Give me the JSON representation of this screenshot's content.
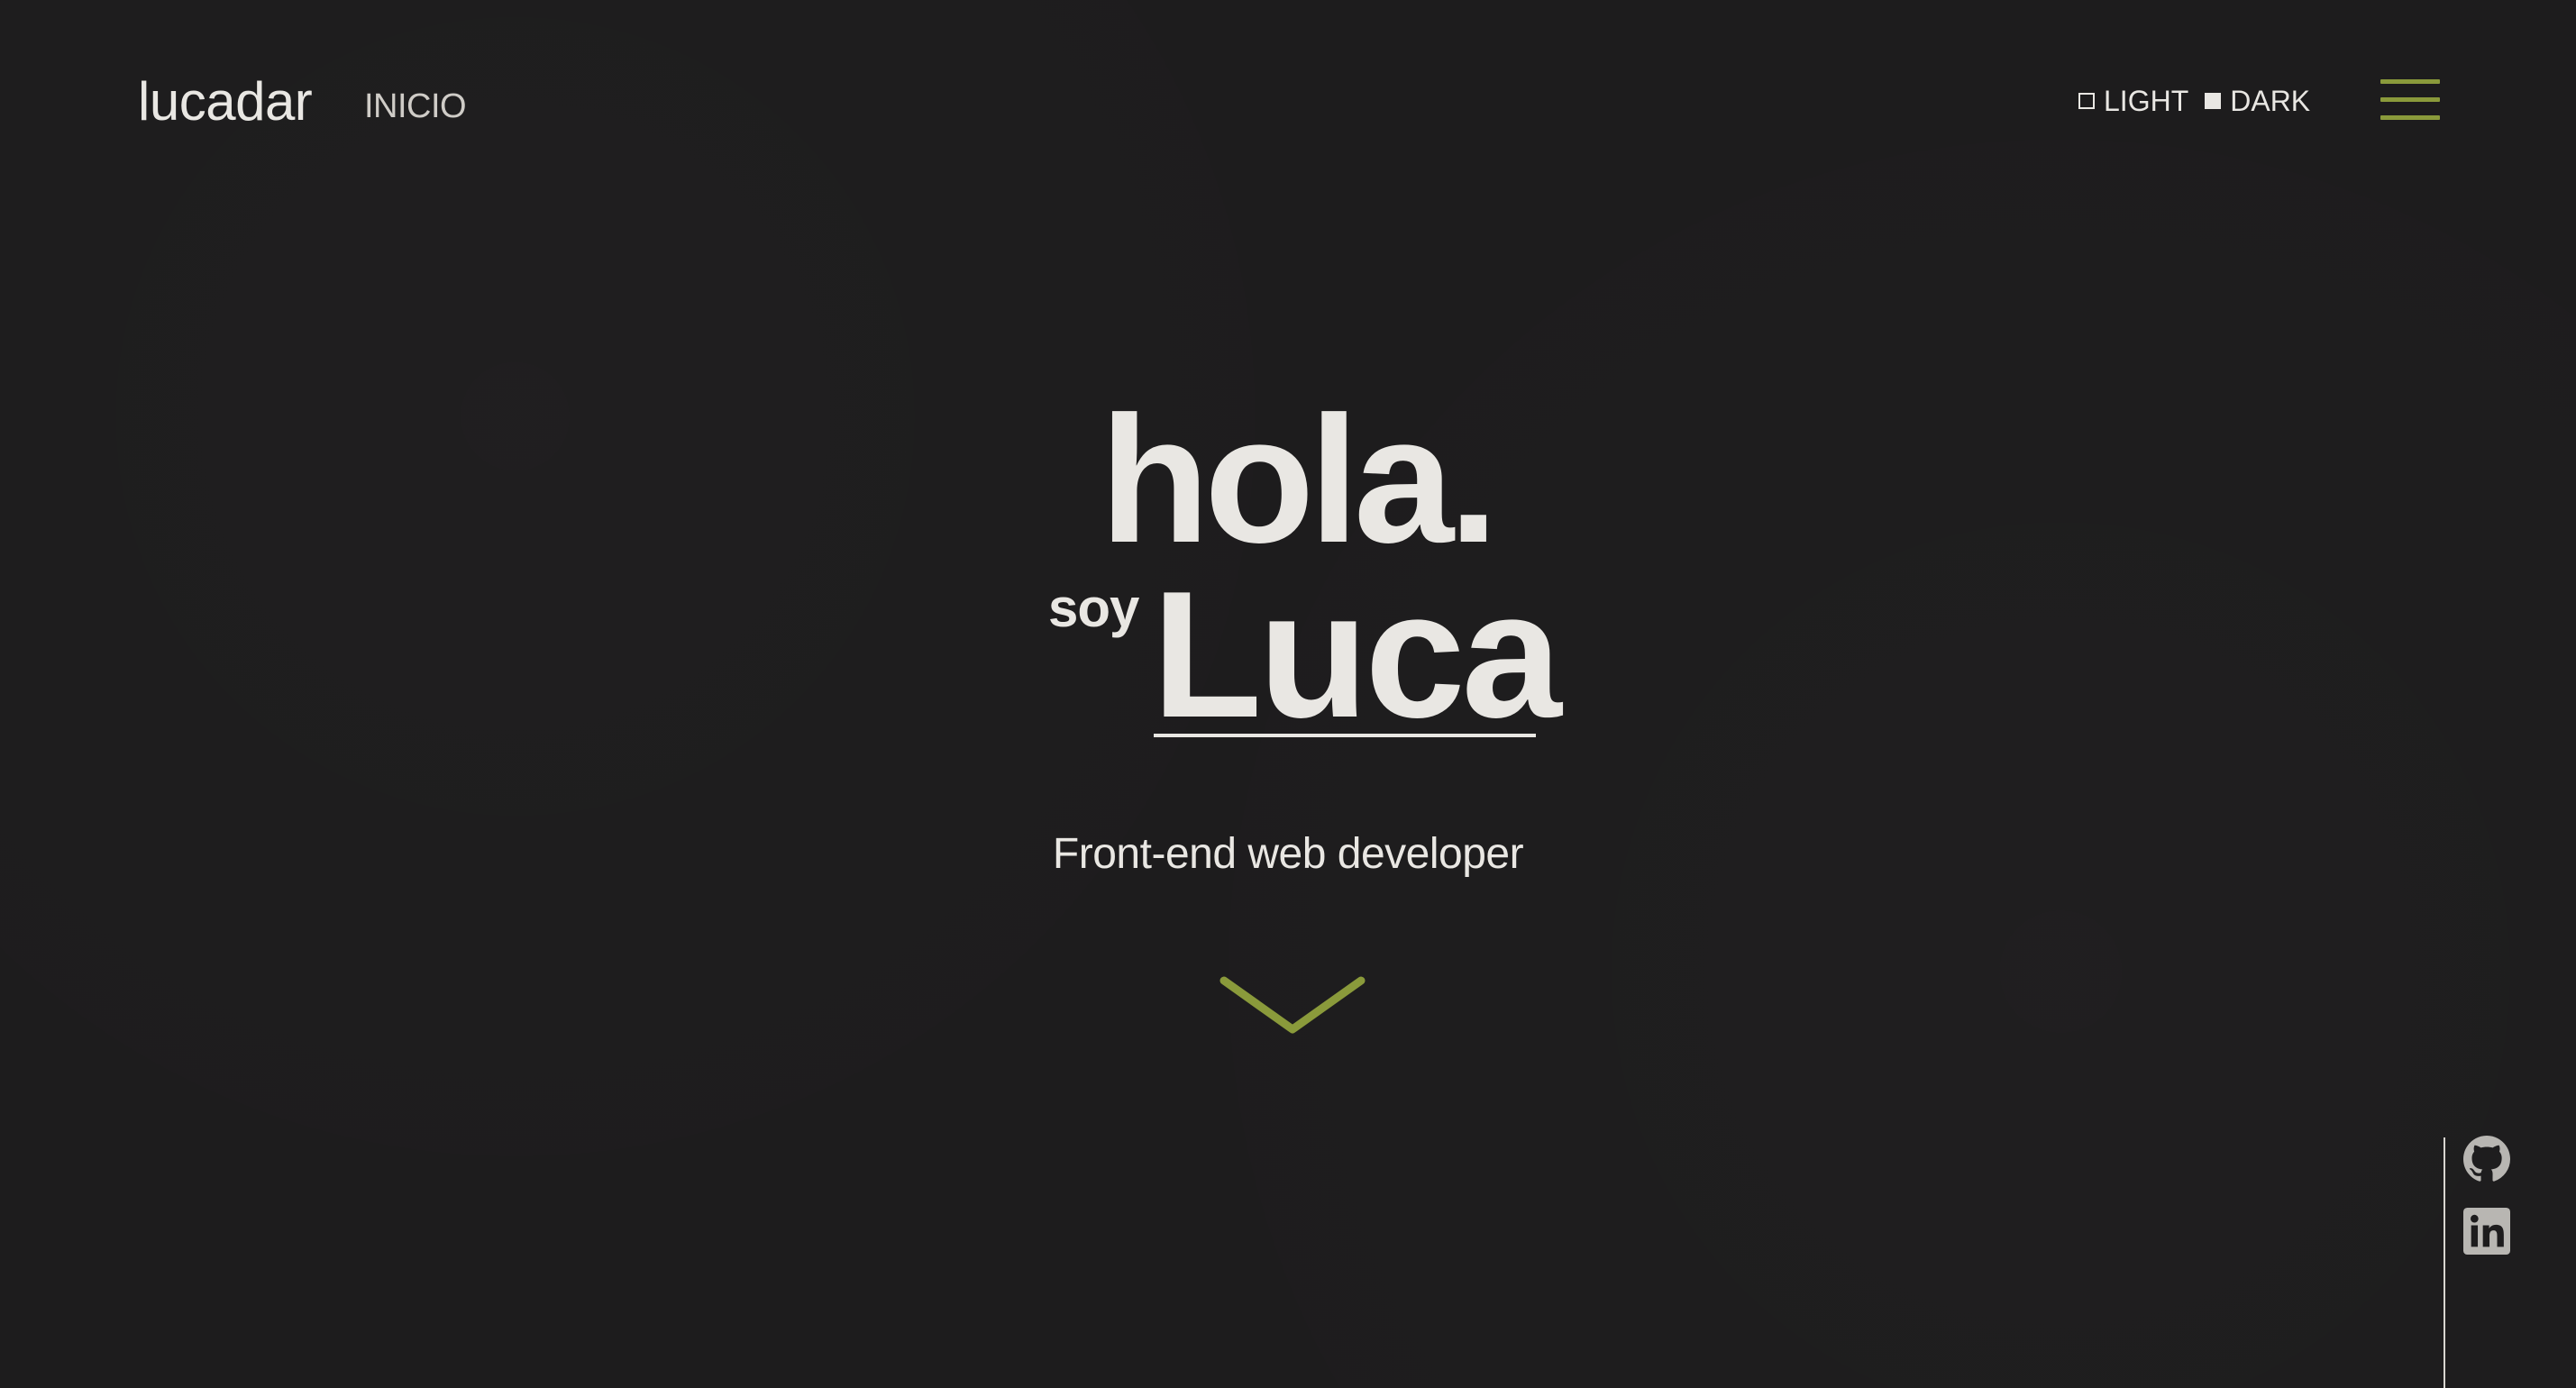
{
  "header": {
    "brand": "lucadar",
    "nav_label": "INICIO",
    "theme_options": [
      {
        "label": "LIGHT",
        "selected": false
      },
      {
        "label": "DARK",
        "selected": true
      }
    ],
    "menu_icon": "hamburger-icon"
  },
  "hero": {
    "greeting": "hola.",
    "intro": "soy",
    "name": "Luca",
    "role": "Front-end web developer",
    "scroll_icon": "chevron-down-icon"
  },
  "social": {
    "items": [
      {
        "icon": "github-icon"
      },
      {
        "icon": "linkedin-icon"
      }
    ]
  },
  "colors": {
    "background": "#1d1c1d",
    "text": "#e9e7e3",
    "accent": "#8a9a3b",
    "icon": "#b8b6b2"
  }
}
